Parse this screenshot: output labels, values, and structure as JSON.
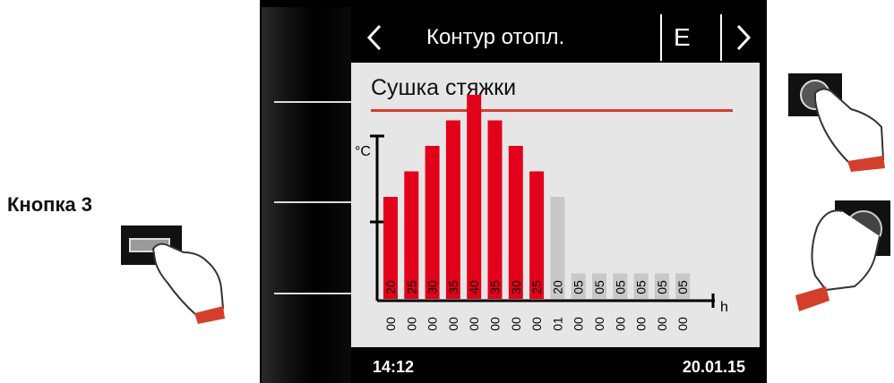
{
  "side_label": "Кнопка 3",
  "header": {
    "title": "Контур отопл.",
    "e_label": "E",
    "back_icon": "chevron-left-icon",
    "forward_icon": "chevron-right-icon"
  },
  "panel": {
    "subtitle": "Сушка стяжки"
  },
  "footer": {
    "time": "14:12",
    "date": "20.01.15"
  },
  "colors": {
    "active_bar": "#e3001b",
    "inactive_bar": "#c8c8c8",
    "accent_line": "#d43f2b"
  },
  "chart_data": {
    "type": "bar",
    "ylabel": "°C",
    "xlabel": "h",
    "categories": [
      "00",
      "00",
      "00",
      "00",
      "00",
      "00",
      "00",
      "00",
      "01",
      "00",
      "00",
      "00",
      "00",
      "00",
      "00"
    ],
    "values": [
      20,
      25,
      30,
      35,
      40,
      35,
      30,
      25,
      20,
      5,
      5,
      5,
      5,
      5,
      5
    ],
    "value_labels": [
      "20",
      "25",
      "30",
      "35",
      "40",
      "35",
      "30",
      "25",
      "20",
      "05",
      "05",
      "05",
      "05",
      "05",
      "05"
    ],
    "active_count": 8
  }
}
